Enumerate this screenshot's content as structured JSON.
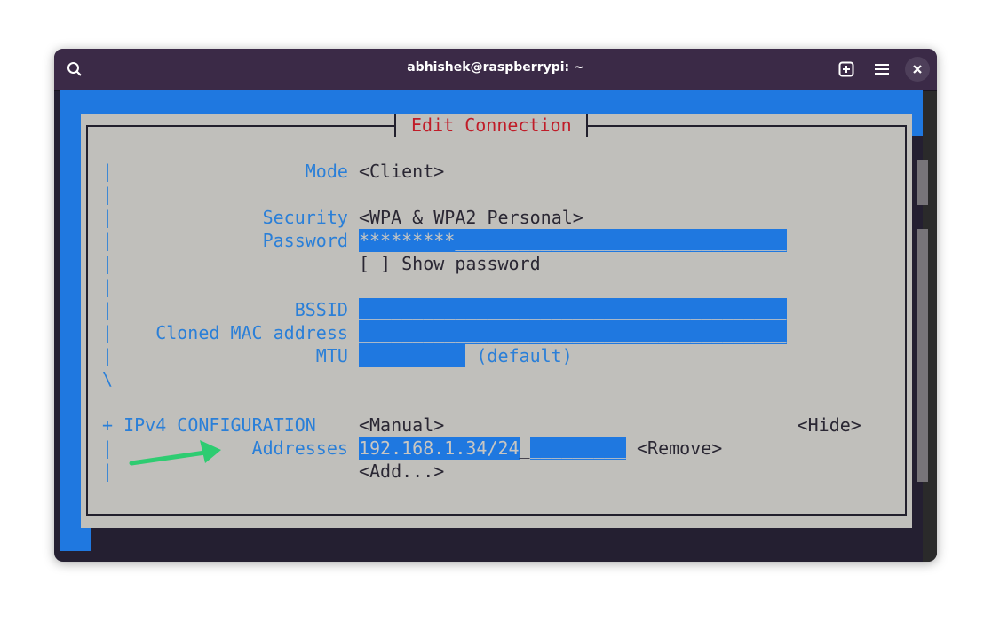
{
  "window": {
    "title": "abhishek@raspberrypi: ~",
    "icons": [
      "search-icon",
      "new-tab-icon",
      "menu-icon",
      "close-icon"
    ]
  },
  "dialog": {
    "title": "Edit Connection",
    "rows": [
      {
        "gutter": "|",
        "label": "Mode",
        "value": "<Client>"
      },
      {
        "gutter": "|"
      },
      {
        "gutter": "|",
        "label": "Security",
        "value": "<WPA & WPA2 Personal>"
      },
      {
        "gutter": "|",
        "label": "Password",
        "field": "*********_______________________________"
      },
      {
        "gutter": "|",
        "value": "[ ] Show password"
      },
      {
        "gutter": "|"
      },
      {
        "gutter": "|",
        "label": "BSSID",
        "field": "________________________________________"
      },
      {
        "gutter": "|",
        "label": "Cloned MAC address",
        "field": "________________________________________"
      },
      {
        "gutter": "|",
        "label": "MTU",
        "field": "__________",
        "suffix": "(default)"
      },
      {
        "gutter": "\\"
      }
    ],
    "ipv4": {
      "toggle": "+",
      "label": "IPv4 CONFIGURATION",
      "method": "<Manual>",
      "hide": "<Hide>",
      "addresses_label": "Addresses",
      "address_value": "192.168.1.34/24",
      "address_sep": "_",
      "address_rest": "_________",
      "remove": "<Remove>",
      "add": "<Add...>",
      "gutter": "|"
    }
  },
  "colors": {
    "accent": "#1f78e0",
    "label": "#2a7fd8",
    "title": "#c01c28",
    "dialog_bg": "#c0bfbb",
    "annotation_arrow": "#2ecc71"
  }
}
